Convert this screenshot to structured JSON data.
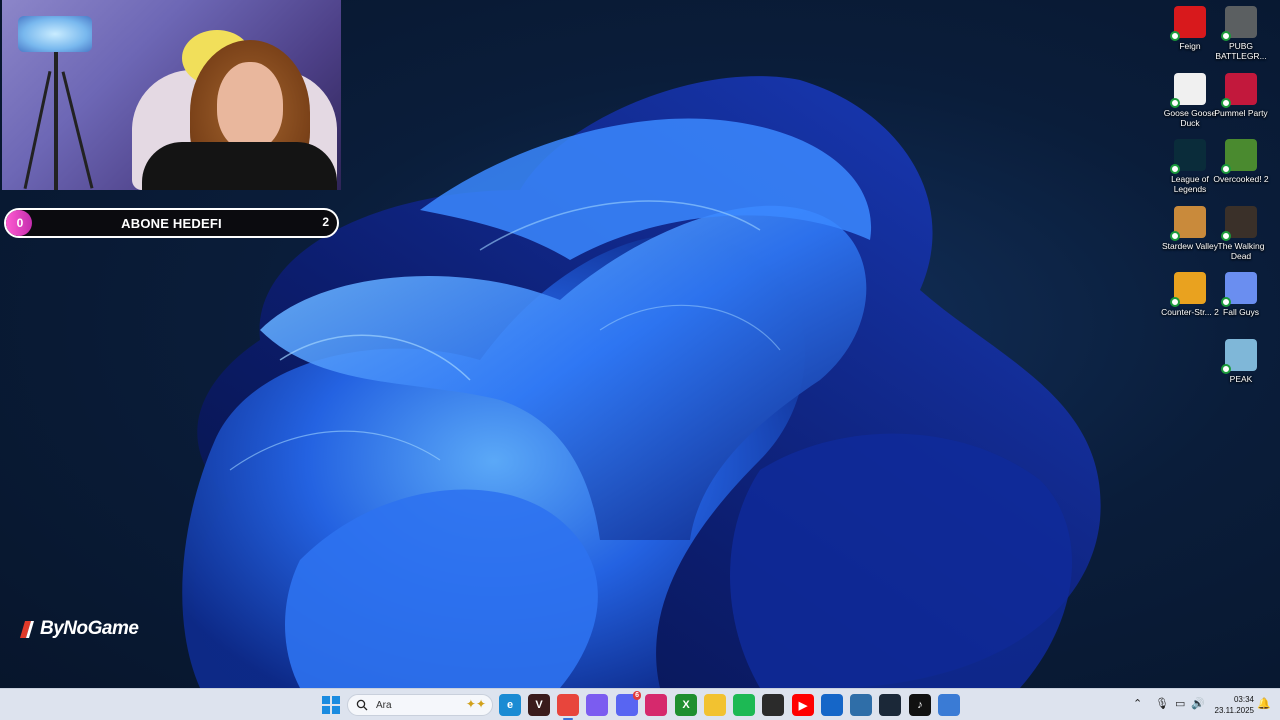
{
  "overlay": {
    "goal": {
      "current": "0",
      "label": "ABONE HEDEFI",
      "target": "2",
      "progress_fraction": 0.0
    },
    "watermark": "ByNoGame"
  },
  "desktop_icons": [
    {
      "name": "Feign",
      "icon": "feign-icon",
      "color": "#d8191c"
    },
    {
      "name": "PUBG BATTLEGR...",
      "icon": "pubg-icon",
      "color": "#5b5f61"
    },
    {
      "name": "Goose Goose Duck",
      "icon": "goose-goose-duck-icon",
      "color": "#f0f0f0"
    },
    {
      "name": "Pummel Party",
      "icon": "pummel-party-icon",
      "color": "#c2183c"
    },
    {
      "name": "League of Legends",
      "icon": "league-of-legends-icon",
      "color": "#0a2c3a"
    },
    {
      "name": "Overcooked! 2",
      "icon": "overcooked-2-icon",
      "color": "#4a8a2f"
    },
    {
      "name": "Stardew Valley",
      "icon": "stardew-valley-icon",
      "color": "#c98a3b"
    },
    {
      "name": "The Walking Dead",
      "icon": "the-walking-dead-icon",
      "color": "#3a3029"
    },
    {
      "name": "Counter-Str... 2",
      "icon": "counter-strike-2-icon",
      "color": "#e9a21f"
    },
    {
      "name": "Fall Guys",
      "icon": "fall-guys-icon",
      "color": "#6a8ef0"
    },
    {
      "name": "PEAK",
      "icon": "peak-icon",
      "color": "#7fb7d8"
    }
  ],
  "taskbar": {
    "search_placeholder": "Ara",
    "apps": [
      {
        "name": "start-button",
        "glyph": "",
        "color": "#1a8be0"
      },
      {
        "name": "edge-icon",
        "glyph": "e",
        "color": "#1b8bd3"
      },
      {
        "name": "valorant-icon",
        "glyph": "V",
        "color": "#3a1b1b"
      },
      {
        "name": "chrome-icon",
        "glyph": "",
        "color": "#e8453c"
      },
      {
        "name": "copilot-icon",
        "glyph": "",
        "color": "#7b5cf0"
      },
      {
        "name": "discord-icon",
        "glyph": "",
        "color": "#5865f2",
        "badge": "6"
      },
      {
        "name": "instagram-icon",
        "glyph": "",
        "color": "#d6296d"
      },
      {
        "name": "xbox-icon",
        "glyph": "X",
        "color": "#1f8f2f"
      },
      {
        "name": "file-explorer-icon",
        "glyph": "",
        "color": "#f2c230"
      },
      {
        "name": "spotify-icon",
        "glyph": "",
        "color": "#1db954"
      },
      {
        "name": "obs-icon",
        "glyph": "",
        "color": "#2b2b2b"
      },
      {
        "name": "youtube-icon",
        "glyph": "▶",
        "color": "#ff0000"
      },
      {
        "name": "mail-icon",
        "glyph": "",
        "color": "#1566c8"
      },
      {
        "name": "notepad-icon",
        "glyph": "",
        "color": "#2f6ea8"
      },
      {
        "name": "steam-icon",
        "glyph": "",
        "color": "#1b2838"
      },
      {
        "name": "tiktok-icon",
        "glyph": "♪",
        "color": "#111111"
      },
      {
        "name": "settings-app-icon",
        "glyph": "",
        "color": "#3a7bd5"
      }
    ],
    "clock_time": "03:34",
    "clock_date": "23.11.2025"
  },
  "colors": {
    "wallpaper_bg": "#0a1d3a",
    "bloom": "#2a6df0",
    "goal_accent": "#e040c0",
    "taskbar_bg": "#dde3ee"
  }
}
